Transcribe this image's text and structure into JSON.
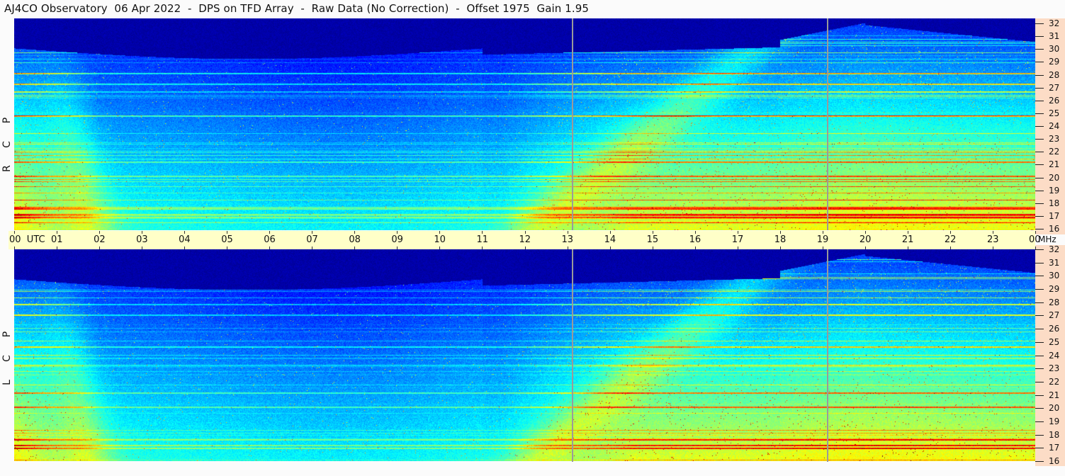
{
  "title": "AJ4CO Observatory  06 Apr 2022  -  DPS on TFD Array  -  Raw Data (No Correction)  -  Offset 1975  Gain 1.95",
  "panels": [
    {
      "id": "rcp",
      "letters": [
        "R",
        "C",
        "P"
      ]
    },
    {
      "id": "lcp",
      "letters": [
        "L",
        "C",
        "P"
      ]
    }
  ],
  "time_axis": {
    "labels": [
      "00  UTC",
      "01",
      "02",
      "03",
      "04",
      "05",
      "06",
      "07",
      "08",
      "09",
      "10",
      "11",
      "12",
      "13",
      "14",
      "15",
      "16",
      "17",
      "18",
      "19",
      "20",
      "21",
      "22",
      "23",
      "00"
    ],
    "unit": "MHz"
  },
  "colors": {
    "background": "#fbfbfb",
    "time_axis_bg": "#ffffc8",
    "freq_axis_bg": "#fcdcc6",
    "marker_line": "#9a9a9a"
  },
  "chart_data": {
    "type": "heatmap",
    "title": "AJ4CO Observatory  06 Apr 2022  -  DPS on TFD Array  -  Raw Data (No Correction)  -  Offset 1975  Gain 1.95",
    "x_axis": {
      "quantity": "time (UTC hours)",
      "range": [
        0,
        24
      ],
      "ticks": [
        "00  UTC",
        "01",
        "02",
        "03",
        "04",
        "05",
        "06",
        "07",
        "08",
        "09",
        "10",
        "11",
        "12",
        "13",
        "14",
        "15",
        "16",
        "17",
        "18",
        "19",
        "20",
        "21",
        "22",
        "23",
        "00"
      ]
    },
    "y_axis": {
      "quantity": "frequency (MHz)",
      "range": [
        16,
        32
      ],
      "ticks": [
        16,
        17,
        18,
        19,
        20,
        21,
        22,
        23,
        24,
        25,
        26,
        27,
        28,
        29,
        30,
        31,
        32
      ],
      "unit": "MHz"
    },
    "panels": [
      "RCP",
      "LCP"
    ],
    "marker_times_utc": [
      13.13,
      19.13
    ],
    "colormap": "jet (dark blue low, green/yellow/red high)"
  }
}
